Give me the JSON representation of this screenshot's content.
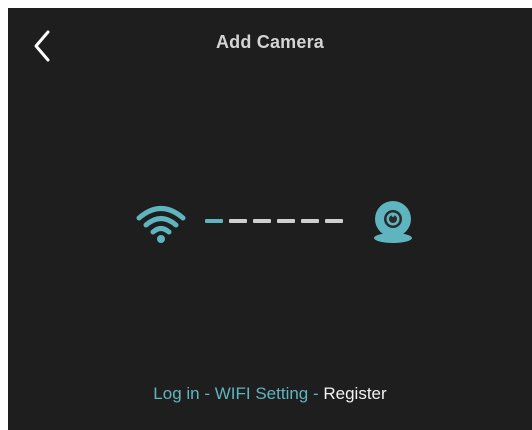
{
  "header": {
    "back_icon": "chevron-left-icon",
    "title": "Add Camera"
  },
  "illustration": {
    "wifi_icon": "wifi-icon",
    "camera_icon": "camera-icon",
    "dash_count": 6,
    "dashes_completed": 1
  },
  "steps": {
    "items": [
      {
        "label": "Log in",
        "state": "done"
      },
      {
        "label": "WIFI Setting",
        "state": "done"
      },
      {
        "label": "Register",
        "state": "current"
      }
    ],
    "separator": " - "
  },
  "colors": {
    "background": "#1e1e1e",
    "accent": "#5fb5bf",
    "dash_active": "#5fb5bf",
    "dash_inactive": "#cfcfcf",
    "title": "#d4d4d4",
    "current_step": "#f2f2f2"
  }
}
